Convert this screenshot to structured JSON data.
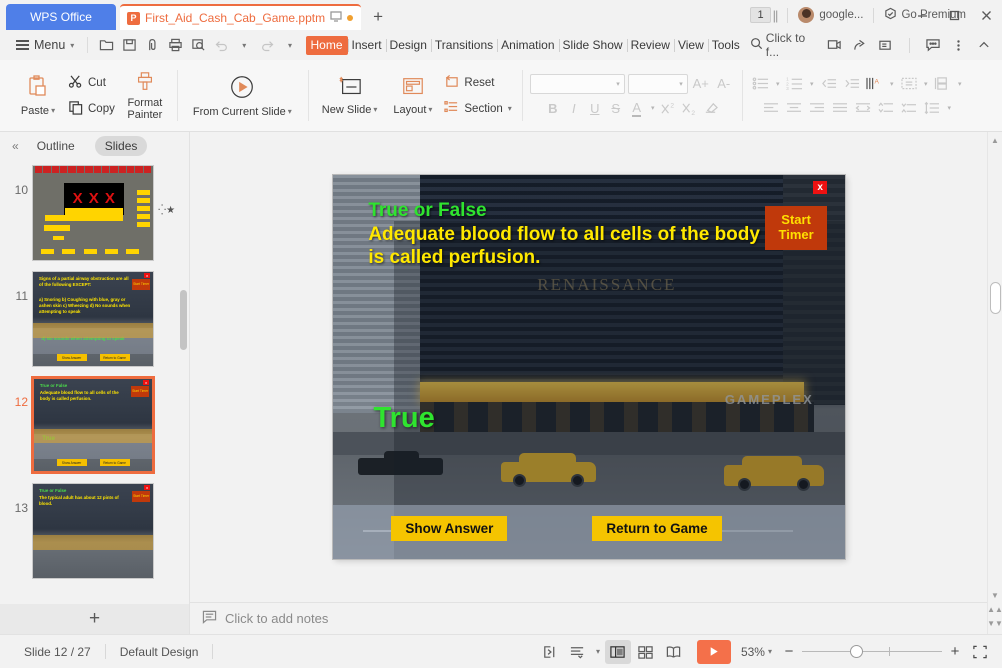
{
  "window": {
    "minimize": "minimize-icon",
    "maximize": "maximize-icon",
    "close": "close-icon"
  },
  "tabbar": {
    "wps_button": "WPS Office",
    "document_tab": "First_Aid_Cash_Cab_Game.pptm",
    "document_tab_icon": "P",
    "new_tab": "+",
    "slide_counter": "1",
    "account_name": "google...",
    "premium_label": "Go Premium"
  },
  "quickaccess": {
    "menu": "Menu",
    "items": [
      "open-icon",
      "save-icon",
      "save-as-icon",
      "print-icon",
      "print-preview-icon",
      "undo-icon",
      "redo-icon",
      "customize-icon"
    ]
  },
  "ribbon_tabs": {
    "active": "Home",
    "items": [
      "Home",
      "Insert",
      "Design",
      "Transitions",
      "Animation",
      "Slide Show",
      "Review",
      "View",
      "Tools"
    ]
  },
  "ribbon_right": {
    "find_label": "Click to f...",
    "icons": [
      "screen-record-icon",
      "share-icon",
      "export-icon",
      "comment-icon",
      "more-icon",
      "collapse-ribbon-icon"
    ]
  },
  "ribbon": {
    "paste": "Paste",
    "cut": "Cut",
    "copy": "Copy",
    "format_painter": "Format Painter",
    "from_current_slide": "From Current Slide",
    "new_slide": "New Slide",
    "layout": "Layout",
    "reset": "Reset",
    "section": "Section",
    "font_name": "",
    "font_size": "",
    "grow_font": "A+",
    "shrink_font": "A-",
    "bold": "B",
    "italic": "I",
    "underline": "U",
    "strikethrough": "S",
    "font_color": "A",
    "superscript": "X2",
    "subscript": "X2",
    "clear_format": "clear-formatting-icon"
  },
  "left_panel": {
    "collapse": "«",
    "outline_tab": "Outline",
    "slides_tab": "Slides",
    "add_slide": "+",
    "thumbnails": [
      {
        "number": "10",
        "type": "board",
        "has_star": true
      },
      {
        "number": "11",
        "type": "question",
        "prompt": "Signs of a partial airway obstruction are all of the following EXCEPT:",
        "choices": "a) Snoring b) Coughing with blue, gray or ashen skin c) Wheezing d) No sounds when attempting to speak",
        "answer": "d) No sounds when attempting to speak",
        "timer": "Start Timer",
        "button_left": "Show Answer",
        "button_right": "Return to Game"
      },
      {
        "number": "12",
        "type": "question",
        "selected": true,
        "prompt_title": "True or False",
        "prompt": "Adequate blood flow to all cells of the body is called perfusion.",
        "answer": "True",
        "timer": "Start Timer",
        "button_left": "Show Answer",
        "button_right": "Return to Game"
      },
      {
        "number": "13",
        "type": "question",
        "prompt_title": "True or False",
        "prompt": "The typical adult has about 12 pints of blood.",
        "timer": "Start Timer"
      }
    ]
  },
  "slide": {
    "title": "True or False",
    "question": "Adequate blood flow to all cells of the body is called perfusion.",
    "answer": "True",
    "timer_line1": "Start",
    "timer_line2": "Timer",
    "close_mark": "x",
    "button_show_answer": "Show Answer",
    "button_return": "Return to Game",
    "background_text_renaissance": "RENAISSANCE",
    "background_text_gameplex": "GAMEPLEX"
  },
  "notes": {
    "placeholder": "Click to add notes",
    "icon": "notes-icon"
  },
  "status": {
    "slide_position": "Slide 12 / 27",
    "design": "Default Design",
    "zoom_percent": "53%",
    "view_buttons": [
      "fit-slide-icon",
      "outline-view-icon",
      "normal-view-icon",
      "slide-sorter-icon",
      "reading-view-icon"
    ],
    "play_button": "play-slideshow-icon",
    "zoom_out": "−",
    "zoom_in": "+",
    "fit_to_window": "fit-window-icon"
  },
  "colors": {
    "accent_orange": "#ee6c3f",
    "wps_blue": "#4f7fe8",
    "slide_yellow": "#ffe800",
    "slide_green": "#2fe42f",
    "button_gold": "#f5c400",
    "timer_red": "#c0390b"
  }
}
